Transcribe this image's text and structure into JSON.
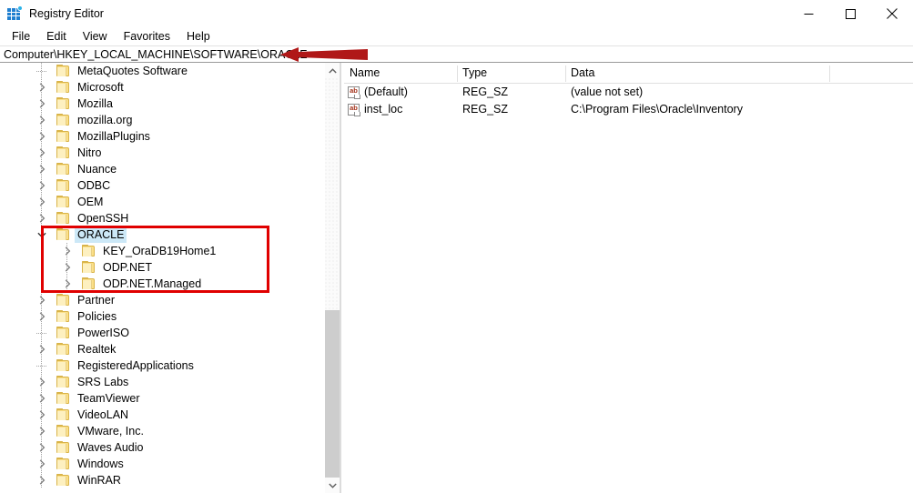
{
  "window": {
    "title": "Registry Editor",
    "icon": "registry-editor-icon",
    "minimize_label": "–",
    "maximize_label": "□",
    "close_label": "×"
  },
  "menubar": {
    "items": [
      {
        "label": "File"
      },
      {
        "label": "Edit"
      },
      {
        "label": "View"
      },
      {
        "label": "Favorites"
      },
      {
        "label": "Help"
      }
    ]
  },
  "address_bar": {
    "path": "Computer\\HKEY_LOCAL_MACHINE\\SOFTWARE\\ORACLE"
  },
  "tree": {
    "items": [
      {
        "label": "MetaQuotes Software",
        "depth": 1,
        "twisty": "none",
        "selected": false
      },
      {
        "label": "Microsoft",
        "depth": 1,
        "twisty": "collapsed",
        "selected": false
      },
      {
        "label": "Mozilla",
        "depth": 1,
        "twisty": "collapsed",
        "selected": false
      },
      {
        "label": "mozilla.org",
        "depth": 1,
        "twisty": "collapsed",
        "selected": false
      },
      {
        "label": "MozillaPlugins",
        "depth": 1,
        "twisty": "collapsed",
        "selected": false
      },
      {
        "label": "Nitro",
        "depth": 1,
        "twisty": "collapsed",
        "selected": false
      },
      {
        "label": "Nuance",
        "depth": 1,
        "twisty": "collapsed",
        "selected": false
      },
      {
        "label": "ODBC",
        "depth": 1,
        "twisty": "collapsed",
        "selected": false
      },
      {
        "label": "OEM",
        "depth": 1,
        "twisty": "collapsed",
        "selected": false
      },
      {
        "label": "OpenSSH",
        "depth": 1,
        "twisty": "collapsed",
        "selected": false
      },
      {
        "label": "ORACLE",
        "depth": 1,
        "twisty": "expanded",
        "selected": true
      },
      {
        "label": "KEY_OraDB19Home1",
        "depth": 2,
        "twisty": "collapsed",
        "selected": false
      },
      {
        "label": "ODP.NET",
        "depth": 2,
        "twisty": "collapsed",
        "selected": false
      },
      {
        "label": "ODP.NET.Managed",
        "depth": 2,
        "twisty": "collapsed",
        "selected": false
      },
      {
        "label": "Partner",
        "depth": 1,
        "twisty": "collapsed",
        "selected": false
      },
      {
        "label": "Policies",
        "depth": 1,
        "twisty": "collapsed",
        "selected": false
      },
      {
        "label": "PowerISO",
        "depth": 1,
        "twisty": "none",
        "selected": false
      },
      {
        "label": "Realtek",
        "depth": 1,
        "twisty": "collapsed",
        "selected": false
      },
      {
        "label": "RegisteredApplications",
        "depth": 1,
        "twisty": "none",
        "selected": false
      },
      {
        "label": "SRS Labs",
        "depth": 1,
        "twisty": "collapsed",
        "selected": false
      },
      {
        "label": "TeamViewer",
        "depth": 1,
        "twisty": "collapsed",
        "selected": false
      },
      {
        "label": "VideoLAN",
        "depth": 1,
        "twisty": "collapsed",
        "selected": false
      },
      {
        "label": "VMware, Inc.",
        "depth": 1,
        "twisty": "collapsed",
        "selected": false
      },
      {
        "label": "Waves Audio",
        "depth": 1,
        "twisty": "collapsed",
        "selected": false
      },
      {
        "label": "Windows",
        "depth": 1,
        "twisty": "collapsed",
        "selected": false
      },
      {
        "label": "WinRAR",
        "depth": 1,
        "twisty": "collapsed",
        "selected": false
      }
    ]
  },
  "tree_scrollbar": {
    "up_arrow": "chevron-up",
    "down_arrow": "chevron-down"
  },
  "list": {
    "columns": [
      {
        "label": "Name"
      },
      {
        "label": "Type"
      },
      {
        "label": "Data"
      }
    ],
    "rows": [
      {
        "name": "(Default)",
        "type": "REG_SZ",
        "data": "(value not set)",
        "icon": "string-value-icon"
      },
      {
        "name": "inst_loc",
        "type": "REG_SZ",
        "data": "C:\\Program Files\\Oracle\\Inventory",
        "icon": "string-value-icon"
      }
    ]
  },
  "annotations": {
    "highlight_color": "#e00000",
    "arrow_color": "#b01818",
    "box_target": "ORACLE key and subkeys",
    "arrow_target": "address bar ORACLE path"
  }
}
